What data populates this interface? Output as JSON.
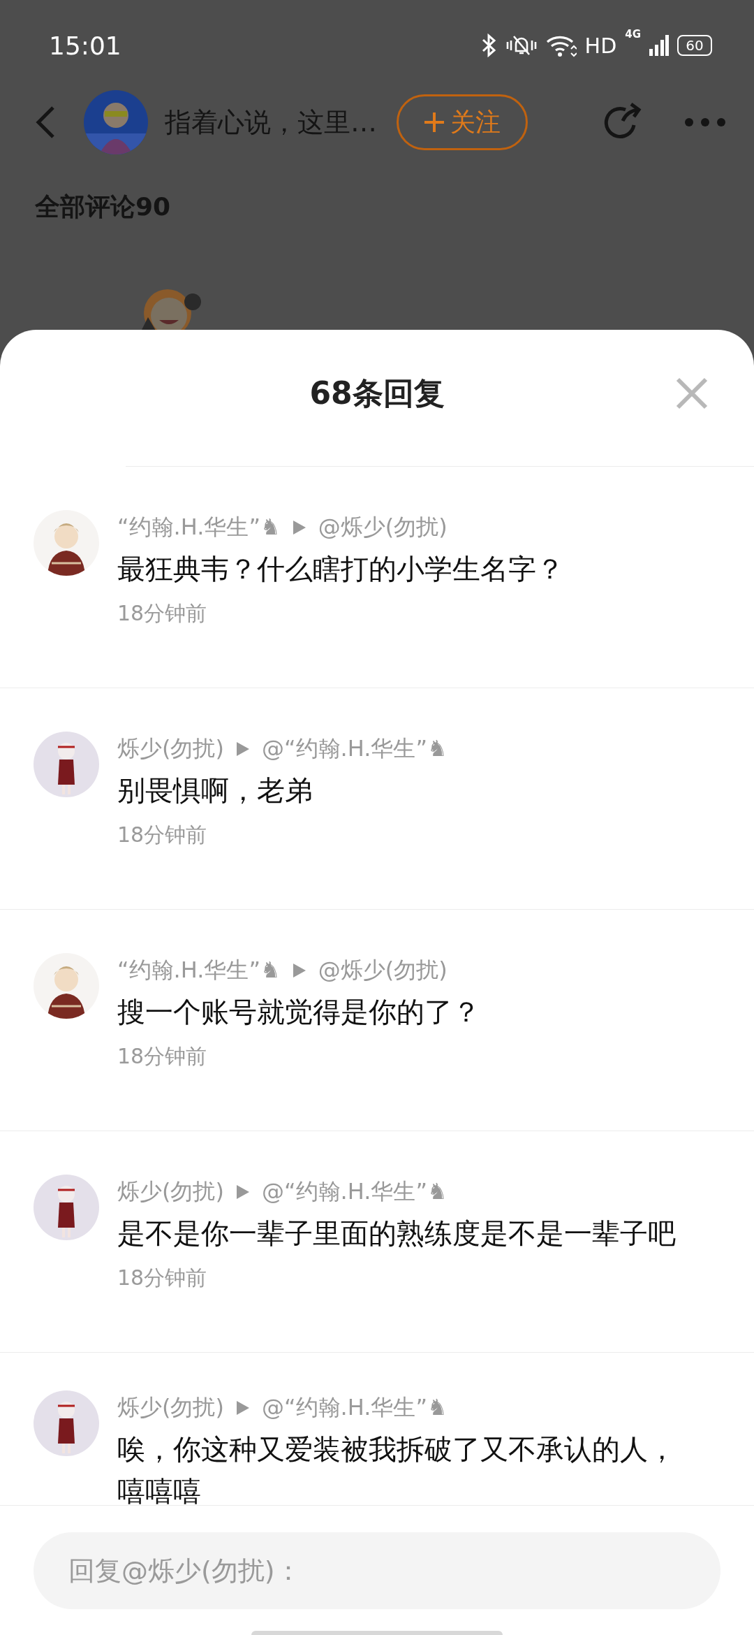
{
  "status_bar": {
    "time": "15:01",
    "network_label": "HD",
    "cellular_label": "4G",
    "battery": "60"
  },
  "header": {
    "title": "指着心说，这里…",
    "follow_button": "关注"
  },
  "section_title": "全部评论90",
  "sheet": {
    "title": "68条回复"
  },
  "replies": [
    {
      "kind": "sweater",
      "author": "“约翰.H.华生”♞",
      "target": "@烁少(勿扰)",
      "text": "最狂典韦？什么瞎打的小学生名字？",
      "time": "18分钟前"
    },
    {
      "kind": "standing",
      "author": "烁少(勿扰)",
      "target": "@“约翰.H.华生”♞",
      "text": "别畏惧啊，老弟",
      "time": "18分钟前"
    },
    {
      "kind": "sweater",
      "author": "“约翰.H.华生”♞",
      "target": "@烁少(勿扰)",
      "text": "搜一个账号就觉得是你的了？",
      "time": "18分钟前"
    },
    {
      "kind": "standing",
      "author": "烁少(勿扰)",
      "target": "@“约翰.H.华生”♞",
      "text": "是不是你一辈子里面的熟练度是不是一辈子吧",
      "time": "18分钟前"
    },
    {
      "kind": "standing",
      "author": "烁少(勿扰)",
      "target": "@“约翰.H.华生”♞",
      "text": "唉，你这种又爱装被我拆破了又不承认的人，嘻嘻嘻"
    }
  ],
  "reply_box": {
    "placeholder": "回复@烁少(勿扰)："
  }
}
